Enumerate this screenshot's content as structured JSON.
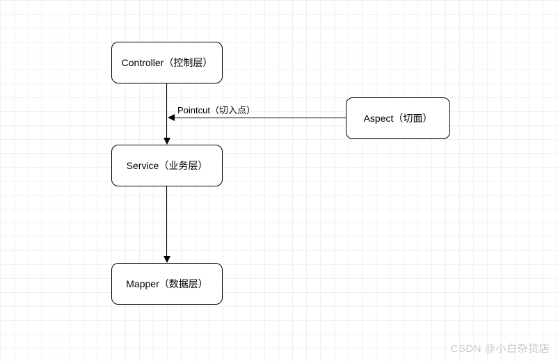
{
  "diagram": {
    "nodes": {
      "controller": "Controller（控制层）",
      "service": "Service（业务层）",
      "mapper": "Mapper（数据层）",
      "aspect": "Aspect（切面）"
    },
    "edges": {
      "pointcut_label": "Pointcut（切入点）"
    }
  },
  "watermark": "CSDN @小白杂货店",
  "chart_data": {
    "type": "flow-diagram",
    "title": "",
    "nodes": [
      {
        "id": "controller",
        "label": "Controller（控制层）"
      },
      {
        "id": "service",
        "label": "Service（业务层）"
      },
      {
        "id": "mapper",
        "label": "Mapper（数据层）"
      },
      {
        "id": "aspect",
        "label": "Aspect（切面）"
      }
    ],
    "edges": [
      {
        "from": "controller",
        "to": "service",
        "label": ""
      },
      {
        "from": "service",
        "to": "mapper",
        "label": ""
      },
      {
        "from": "aspect",
        "to": "controller_service_edge",
        "label": "Pointcut（切入点）"
      }
    ]
  }
}
